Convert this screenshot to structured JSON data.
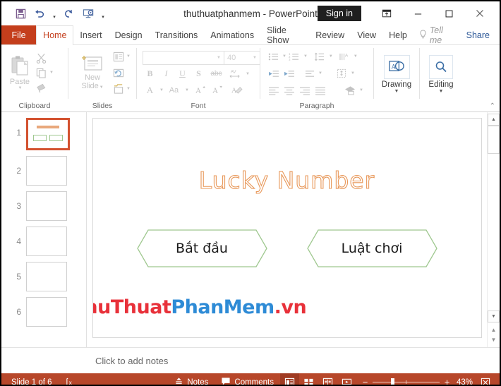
{
  "window": {
    "title": "thuthuatphanmem  -  PowerPoint",
    "signin_label": "Sign in",
    "quick_access": [
      {
        "name": "save-icon",
        "label": "Save"
      },
      {
        "name": "undo-icon",
        "label": "Undo"
      },
      {
        "name": "redo-icon",
        "label": "Redo"
      },
      {
        "name": "start-presentation-icon",
        "label": "Start From Beginning"
      },
      {
        "name": "customize-qat-icon",
        "label": "Customize Quick Access Toolbar"
      }
    ],
    "controls": [
      {
        "name": "ribbon-display-options-icon",
        "label": "Ribbon Display Options"
      },
      {
        "name": "minimize-icon",
        "label": "Minimize"
      },
      {
        "name": "maximize-icon",
        "label": "Maximize"
      },
      {
        "name": "close-icon",
        "label": "Close"
      }
    ]
  },
  "tabs": {
    "file": "File",
    "items": [
      "Home",
      "Insert",
      "Design",
      "Transitions",
      "Animations",
      "Slide Show",
      "Review",
      "View",
      "Help"
    ],
    "active": "Home",
    "tell_me": "Tell me",
    "share": "Share"
  },
  "ribbon": {
    "groups": [
      {
        "label": "Clipboard",
        "paste_label": "Paste"
      },
      {
        "label": "Slides",
        "new_slide_label_line1": "New",
        "new_slide_label_line2": "Slide"
      },
      {
        "label": "Font"
      },
      {
        "label": "Paragraph"
      },
      {
        "label": "Drawing"
      },
      {
        "label": "Editing"
      }
    ],
    "font": {
      "font_name_value": "",
      "font_name_placeholder": "",
      "font_size_value": "40",
      "buttons": [
        "B",
        "I",
        "U",
        "S",
        "abc",
        "AV"
      ]
    },
    "drawing_label": "Drawing",
    "editing_label": "Editing",
    "collapse_label": "Collapse the Ribbon"
  },
  "thumbnails": {
    "selected_index": 1,
    "items": [
      {
        "number": "1",
        "has_content": true
      },
      {
        "number": "2",
        "has_content": false
      },
      {
        "number": "3",
        "has_content": false
      },
      {
        "number": "4",
        "has_content": false
      },
      {
        "number": "5",
        "has_content": false
      },
      {
        "number": "6",
        "has_content": false
      }
    ]
  },
  "slide": {
    "title": "Lucky Number",
    "title_color": "#e8985a",
    "shapes": [
      {
        "name": "start-hexagon",
        "label": "Bắt đầu",
        "outline_color": "#9fc88f"
      },
      {
        "name": "rules-hexagon",
        "label": "Luật chơi",
        "outline_color": "#9fc88f"
      }
    ],
    "watermark": {
      "part1": "ThuThuat",
      "part2": "PhanMem",
      "part3": ".vn",
      "color1": "#e8313a",
      "color2": "#2e8bd6"
    }
  },
  "notes": {
    "placeholder": "Click to add notes"
  },
  "status": {
    "slide_counter": "Slide 1 of 6",
    "spellcheck_name": "spell-check-icon",
    "notes_label": "Notes",
    "comments_label": "Comments",
    "views": [
      {
        "name": "normal-view-icon",
        "active": true
      },
      {
        "name": "slide-sorter-view-icon",
        "active": false
      },
      {
        "name": "reading-view-icon",
        "active": false
      },
      {
        "name": "slideshow-view-icon",
        "active": false
      }
    ],
    "zoom_out": "−",
    "zoom_in": "+",
    "zoom_percent": "43%",
    "fit_slide_name": "fit-slide-to-window-icon"
  }
}
